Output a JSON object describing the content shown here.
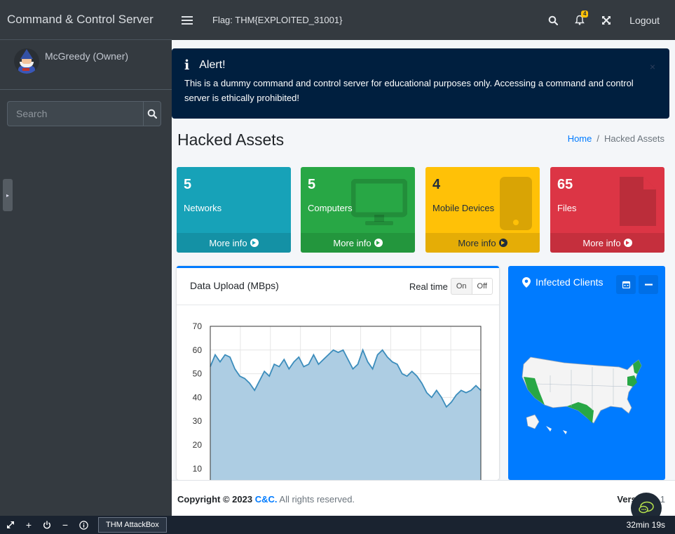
{
  "sidebar": {
    "brand": "Command & Control Server",
    "user_name": "McGreedy (Owner)",
    "search_placeholder": "Search"
  },
  "navbar": {
    "flag": "Flag: THM{EXPLOITED_31001}",
    "notification_count": "4",
    "logout": "Logout"
  },
  "alert": {
    "title": "Alert!",
    "text": "This is a dummy command and control server for educational purposes only. Accessing a command and control server is ethically prohibited!",
    "close": "×"
  },
  "header": {
    "title": "Hacked Assets",
    "breadcrumb_home": "Home",
    "breadcrumb_sep": "/",
    "breadcrumb_current": "Hacked Assets"
  },
  "boxes": [
    {
      "value": "5",
      "label": "Networks",
      "more": "More info",
      "color": "#17a2b8"
    },
    {
      "value": "5",
      "label": "Computers",
      "more": "More info",
      "color": "#28a745"
    },
    {
      "value": "4",
      "label": "Mobile Devices",
      "more": "More info",
      "color": "#ffc107"
    },
    {
      "value": "65",
      "label": "Files",
      "more": "More info",
      "color": "#dc3545"
    }
  ],
  "upload_card": {
    "title": "Data Upload (MBps)",
    "realtime_label": "Real time",
    "on": "On",
    "off": "Off"
  },
  "map_card": {
    "title": "Infected Clients"
  },
  "footer": {
    "copyright_prefix": "Copyright © 2023 ",
    "brand": "C&C.",
    "copyright_suffix": " All rights reserved.",
    "version_label": "Version",
    "version_value": " 1.1"
  },
  "taskbar": {
    "app": "THM AttackBox",
    "timer": "32min 19s"
  },
  "chart_data": {
    "type": "area",
    "ylim": [
      0,
      70
    ],
    "yticks": [
      "10",
      "20",
      "30",
      "40",
      "50",
      "60",
      "70"
    ],
    "values": [
      53,
      58,
      55,
      58,
      57,
      52,
      49,
      48,
      46,
      43,
      47,
      51,
      49,
      54,
      53,
      56,
      52,
      55,
      57,
      53,
      54,
      58,
      54,
      56,
      58,
      60,
      59,
      60,
      56,
      52,
      54,
      60,
      55,
      52,
      58,
      60,
      57,
      55,
      54,
      50,
      49,
      51,
      49,
      46,
      42,
      40,
      43,
      40,
      36,
      38,
      41,
      43,
      42,
      43,
      45,
      43
    ],
    "accent": "#3c8dbc",
    "fill": "#adcde3"
  }
}
